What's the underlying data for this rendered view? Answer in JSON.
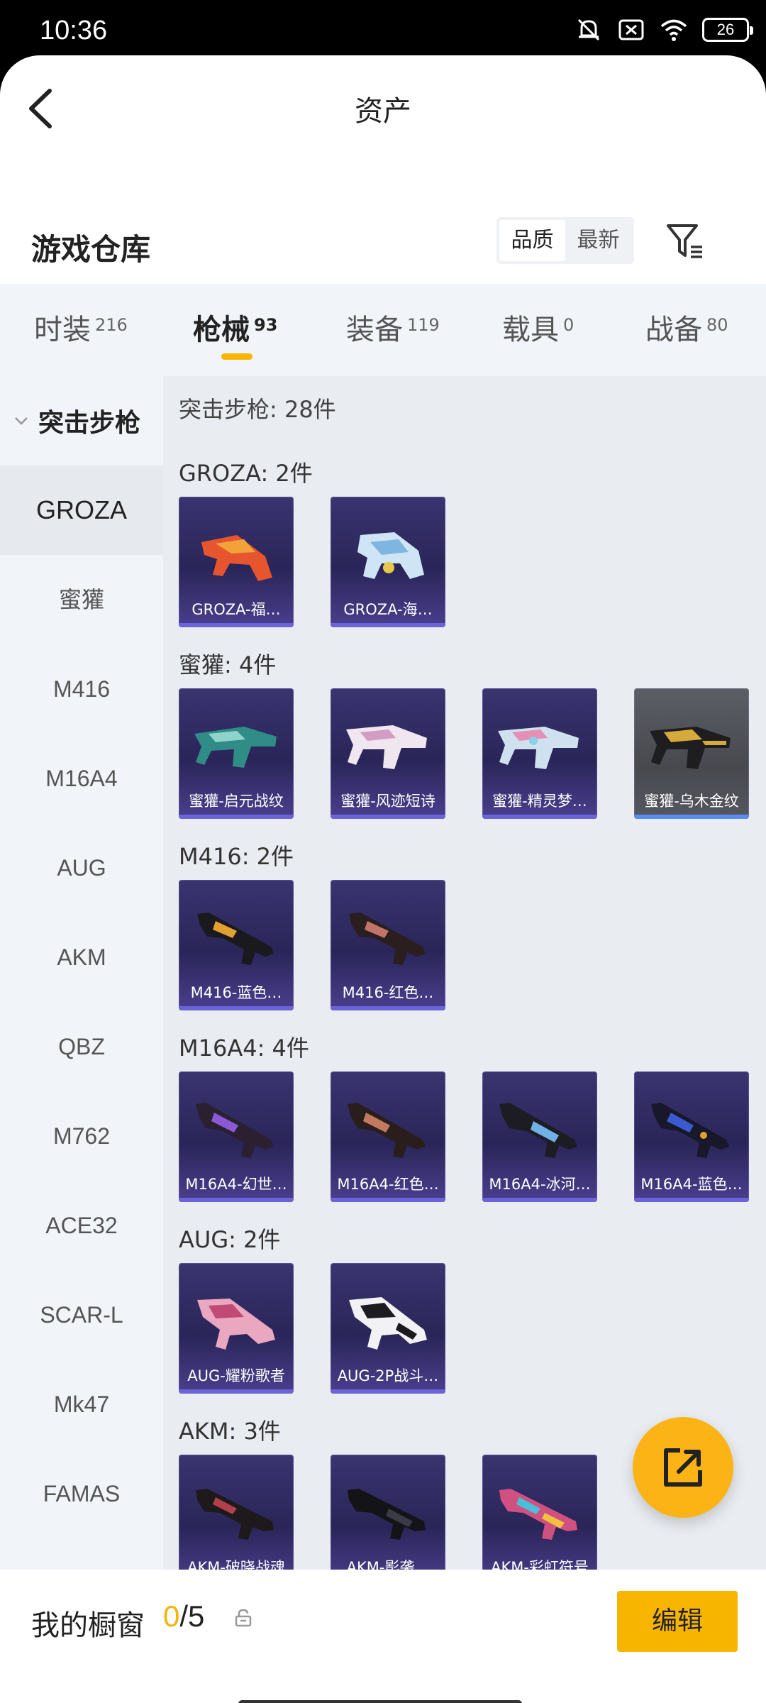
{
  "status_bar": {
    "time": "10:36",
    "battery": "26"
  },
  "header": {
    "title": "资产"
  },
  "warehouse": {
    "title": "游戏仓库",
    "sort_options": [
      "品质",
      "最新"
    ]
  },
  "tabs": [
    {
      "label": "时装",
      "count": "216"
    },
    {
      "label": "枪械",
      "count": "93"
    },
    {
      "label": "装备",
      "count": "119"
    },
    {
      "label": "载具",
      "count": "0"
    },
    {
      "label": "战备",
      "count": "80"
    }
  ],
  "sidebar": {
    "group": "突击步枪",
    "items": [
      "GROZA",
      "蜜獾",
      "M416",
      "M16A4",
      "AUG",
      "AKM",
      "QBZ",
      "M762",
      "ACE32",
      "SCAR-L",
      "Mk47",
      "FAMAS"
    ]
  },
  "content": {
    "total": "突击步枪: 28件",
    "sections": [
      {
        "label": "GROZA: 2件",
        "items": [
          "GROZA-福…",
          "GROZA-海…"
        ]
      },
      {
        "label": "蜜獾: 4件",
        "items": [
          "蜜獾-启元战纹",
          "蜜獾-风迹短诗",
          "蜜獾-精灵梦…",
          "蜜獾-乌木金纹"
        ]
      },
      {
        "label": "M416: 2件",
        "items": [
          "M416-蓝色…",
          "M416-红色…"
        ]
      },
      {
        "label": "M16A4: 4件",
        "items": [
          "M16A4-幻世…",
          "M16A4-红色…",
          "M16A4-冰河…",
          "M16A4-蓝色…"
        ]
      },
      {
        "label": "AUG: 2件",
        "items": [
          "AUG-耀粉歌者",
          "AUG-2P战斗…"
        ]
      },
      {
        "label": "AKM: 3件",
        "items": [
          "AKM-破晓战魂",
          "AKM-影袭…",
          "AKM-彩虹符号"
        ]
      }
    ]
  },
  "bottom": {
    "window_label": "我的橱窗",
    "used": "0",
    "sep_total": "/5",
    "edit_label": "编辑"
  },
  "colors": {
    "accent": "#f7b500",
    "card_bg": "#2a2558",
    "sidebar_bg": "#f1f4f8"
  },
  "icons": [
    "back-arrow-icon",
    "filter-icon",
    "lock-icon",
    "share-icon",
    "chevron-down-icon",
    "mute-icon",
    "sim-icon",
    "wifi-icon"
  ]
}
